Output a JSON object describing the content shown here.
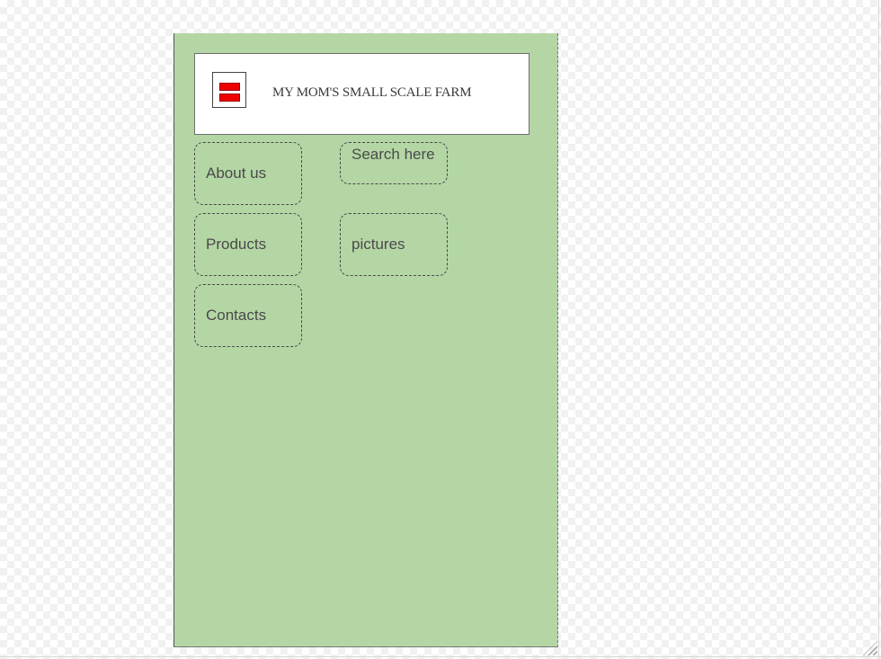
{
  "header": {
    "title": "MY MOM'S SMALL SCALE FARM",
    "menu_icon": "hamburger-menu-icon",
    "menu_icon_color": "#ee0000"
  },
  "nav": {
    "about_label": "About us",
    "products_label": "Products",
    "contacts_label": "Contacts",
    "pictures_label": "pictures"
  },
  "search": {
    "placeholder": "Search here"
  },
  "colors": {
    "app_background": "#b4d6a5",
    "header_background": "#ffffff"
  }
}
